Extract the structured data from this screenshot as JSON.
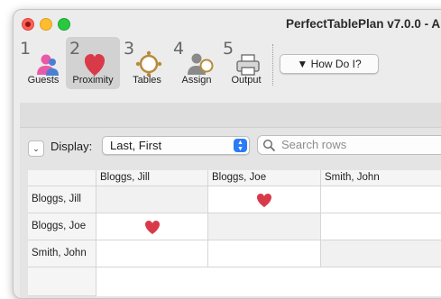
{
  "window": {
    "title": "PerfectTablePlan v7.0.0 - A"
  },
  "toolbar": {
    "tools": [
      {
        "number": "1",
        "label": "Guests",
        "icon": "guests-icon",
        "selected": false
      },
      {
        "number": "2",
        "label": "Proximity",
        "icon": "heart-icon",
        "selected": true
      },
      {
        "number": "3",
        "label": "Tables",
        "icon": "table-icon",
        "selected": false
      },
      {
        "number": "4",
        "label": "Assign",
        "icon": "assign-icon",
        "selected": false
      },
      {
        "number": "5",
        "label": "Output",
        "icon": "printer-icon",
        "selected": false
      }
    ],
    "help_button": "How Do I?",
    "help_arrow": "▼"
  },
  "display": {
    "toggle_glyph": "⌄",
    "label": "Display:",
    "selected": "Last, First",
    "stepper_up": "▲",
    "stepper_down": "▼"
  },
  "search": {
    "placeholder": "Search rows"
  },
  "grid": {
    "columns": [
      "Bloggs, Jill",
      "Bloggs, Joe",
      "Smith, John"
    ],
    "rows": [
      {
        "label": "Bloggs, Jill",
        "hearts": [
          false,
          true,
          false
        ]
      },
      {
        "label": "Bloggs, Joe",
        "hearts": [
          true,
          false,
          false
        ]
      },
      {
        "label": "Smith, John",
        "hearts": [
          false,
          false,
          false
        ]
      }
    ],
    "heart_color": "#d93a4a"
  },
  "colors": {
    "accent": "#2a7cf6",
    "heart": "#d93a4a",
    "selected_tool_bg": "#d2d2d2"
  }
}
